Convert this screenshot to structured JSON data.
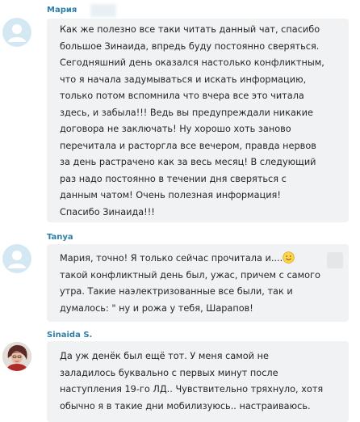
{
  "messages": [
    {
      "author": "Мария",
      "text": "Как же полезно все таки читать данный чат, спасибо\nбольшое Зинаида, впредь буду постоянно сверяться.\nСегодняшний день оказался настолько конфликтным,\nчто я начала задумываться и искать информацию,\nтолько потом вспомнила что вчера все это читала\nздесь, и забыла!!! Ведь вы предупреждали никакие\nдоговора не заключать! Ну хорошо хоть заново\nперечитала и расторгла все вечером, правда нервов\nза день растрачено как за весь месяц! В следующий\nраз надо постоянно в течении дня сверяться с\nданным чатом! Очень полезная информация!\nСпасибо Зинаида!!!"
    },
    {
      "author": "Tanya",
      "text_first": "Мария, точно! Я только сейчас прочитала и....",
      "emoji": "smiling-face-emoji",
      "text_rest": "такой конфликтный день был, ужас, причем с самого\nутра. Такие наэлектризованные все были, так и\nдумалось: \" ну и рожа у тебя, Шарапов!"
    },
    {
      "author": "Sinaida S.",
      "text": "Да уж денёк был ещё тот. У меня самой не\nзаладилось буквально с первых минут после\nнаступления 19-го ЛД.. Чувствительно тряхнуло, хотя\nобычно я в такие дни мобилизуюсь.. настраиваюсь."
    }
  ],
  "colors": {
    "author": "#2d7fa6",
    "bubble": "#f1f2f3",
    "avatar_default": "#d4e8f3"
  }
}
